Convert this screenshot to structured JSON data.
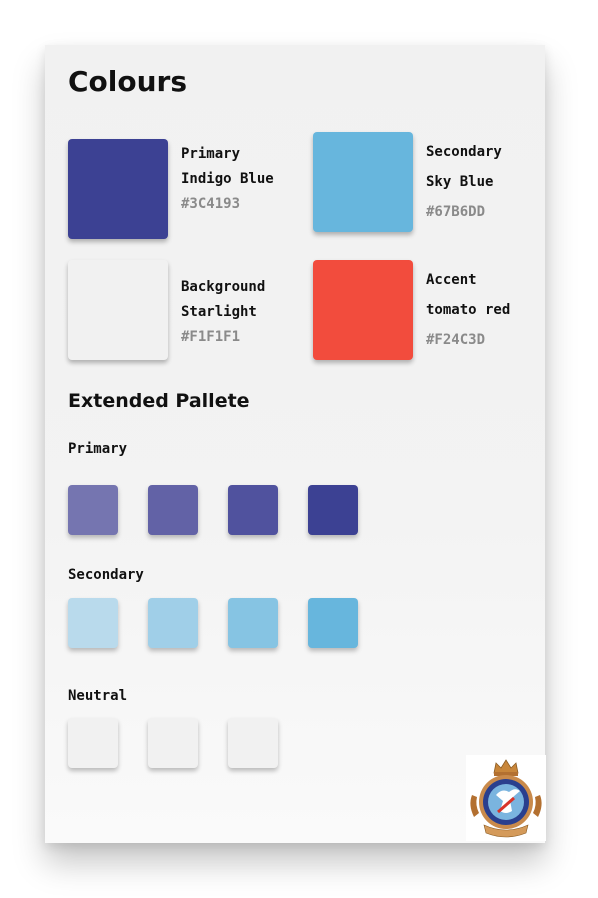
{
  "page": {
    "title": "Colours"
  },
  "main_colors": [
    {
      "line1": "Primary",
      "line2": "Indigo Blue",
      "hex": "#3C4193",
      "color": "#3C4193"
    },
    {
      "line1": "Secondary",
      "line2": "Sky Blue",
      "hex": "#67B6DD",
      "color": "#67B6DD"
    },
    {
      "line1": "Background",
      "line2": "Starlight",
      "hex": "#F1F1F1",
      "color": "#F1F1F1"
    },
    {
      "line1": "Accent",
      "line2": "tomato red",
      "hex": "#F24C3D",
      "color": "#F24C3D"
    }
  ],
  "extended": {
    "title": "Extended Pallete",
    "groups": [
      {
        "label": "Primary",
        "colors": [
          "#7575B0",
          "#6262A6",
          "#50529E",
          "#3C4193"
        ]
      },
      {
        "label": "Secondary",
        "colors": [
          "#B9DAEC",
          "#A0CFE8",
          "#86C4E3",
          "#67B6DD"
        ]
      },
      {
        "label": "Neutral",
        "colors": [
          "#F1F1F1",
          "#F1F1F1",
          "#F1F1F1"
        ]
      }
    ]
  }
}
